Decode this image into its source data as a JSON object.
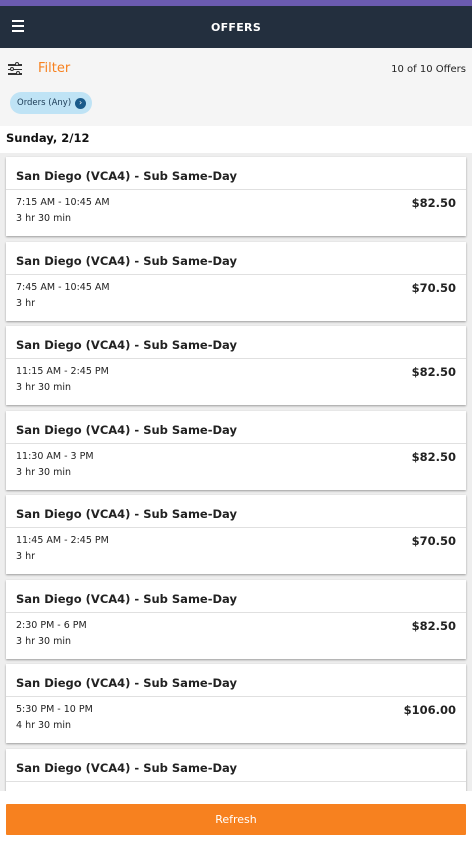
{
  "header": {
    "title": "OFFERS"
  },
  "toolbar": {
    "filter_label": "Filter",
    "offer_count": "10 of 10 Offers",
    "chip_label": "Orders (Any)"
  },
  "date_heading": "Sunday, 2/12",
  "offers": [
    {
      "title": "San Diego (VCA4) - Sub Same-Day",
      "time": "7:15 AM - 10:45 AM",
      "duration": "3 hr 30 min",
      "price": "$82.50"
    },
    {
      "title": "San Diego (VCA4) - Sub Same-Day",
      "time": "7:45 AM - 10:45 AM",
      "duration": "3 hr",
      "price": "$70.50"
    },
    {
      "title": "San Diego (VCA4) - Sub Same-Day",
      "time": "11:15 AM - 2:45 PM",
      "duration": "3 hr 30 min",
      "price": "$82.50"
    },
    {
      "title": "San Diego (VCA4) - Sub Same-Day",
      "time": "11:30 AM - 3 PM",
      "duration": "3 hr 30 min",
      "price": "$82.50"
    },
    {
      "title": "San Diego (VCA4) - Sub Same-Day",
      "time": "11:45 AM - 2:45 PM",
      "duration": "3 hr",
      "price": "$70.50"
    },
    {
      "title": "San Diego (VCA4) - Sub Same-Day",
      "time": "2:30 PM - 6 PM",
      "duration": "3 hr 30 min",
      "price": "$82.50"
    },
    {
      "title": "San Diego (VCA4) - Sub Same-Day",
      "time": "5:30 PM - 10 PM",
      "duration": "4 hr 30 min",
      "price": "$106.00"
    },
    {
      "title": "San Diego (VCA4) - Sub Same-Day",
      "time": "",
      "duration": "",
      "price": ""
    }
  ],
  "footer": {
    "refresh_label": "Refresh"
  },
  "colors": {
    "accent": "#f7811f",
    "header_bg": "#232f3e",
    "chip_bg": "#bfe3f5"
  }
}
